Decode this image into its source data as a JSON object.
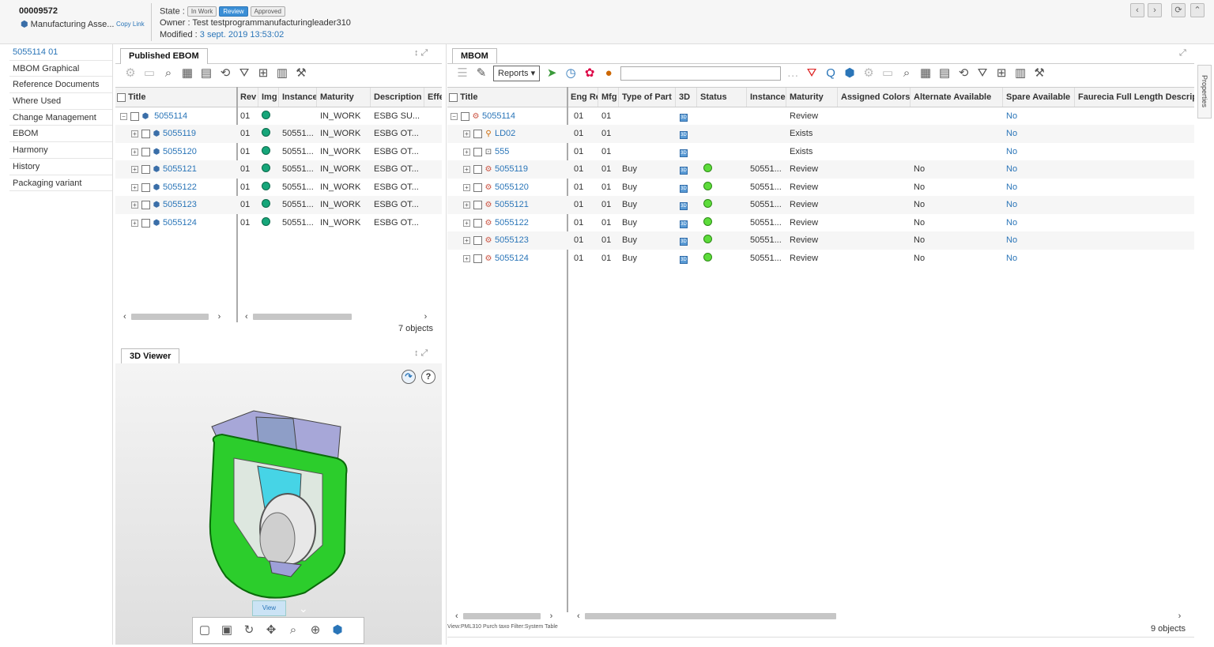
{
  "header": {
    "id": "00009572",
    "type_label": "Manufacturing Asse...",
    "copy_link": "Copy Link",
    "state_label": "State :",
    "states": [
      "In Work",
      "Review",
      "Approved"
    ],
    "owner": "Owner : Test testprogrammanufacturingleader310",
    "modified_label": "Modified :",
    "modified_value": "3 sept. 2019 13:53:02"
  },
  "sidebar": {
    "items": [
      "5055114 01",
      "MBOM Graphical",
      "Reference Documents",
      "Where Used",
      "Change Management",
      "EBOM",
      "Harmony",
      "History",
      "Packaging variant"
    ]
  },
  "ebom": {
    "tab": "Published EBOM",
    "left_header": "Title",
    "columns": [
      "Rev",
      "Img",
      "Instance",
      "Maturity",
      "Description",
      "Effe"
    ],
    "rows": [
      {
        "title": "5055114",
        "rev": "01",
        "instance": "",
        "maturity": "IN_WORK",
        "description": "ESBG SU..."
      },
      {
        "title": "5055119",
        "rev": "01",
        "instance": "50551...",
        "maturity": "IN_WORK",
        "description": "ESBG OT..."
      },
      {
        "title": "5055120",
        "rev": "01",
        "instance": "50551...",
        "maturity": "IN_WORK",
        "description": "ESBG OT..."
      },
      {
        "title": "5055121",
        "rev": "01",
        "instance": "50551...",
        "maturity": "IN_WORK",
        "description": "ESBG OT..."
      },
      {
        "title": "5055122",
        "rev": "01",
        "instance": "50551...",
        "maturity": "IN_WORK",
        "description": "ESBG OT..."
      },
      {
        "title": "5055123",
        "rev": "01",
        "instance": "50551...",
        "maturity": "IN_WORK",
        "description": "ESBG OT..."
      },
      {
        "title": "5055124",
        "rev": "01",
        "instance": "50551...",
        "maturity": "IN_WORK",
        "description": "ESBG OT..."
      }
    ],
    "count": "7 objects"
  },
  "viewer": {
    "tab": "3D Viewer",
    "view_label": "View"
  },
  "mbom": {
    "tab": "MBOM",
    "reports": "Reports",
    "left_header": "Title",
    "properties": "Properties",
    "columns": [
      "Eng Re",
      "Mfg I",
      "Type of Part",
      "3D",
      "Status",
      "Instance",
      "Maturity",
      "Assigned Colors",
      "Alternate Available",
      "Spare Available",
      "Faurecia Full Length Descrip"
    ],
    "rows": [
      {
        "title": "5055114",
        "eng": "01",
        "mfg": "01",
        "type": "",
        "status": false,
        "instance": "",
        "maturity": "Review",
        "alt": "",
        "spare": "No"
      },
      {
        "title": "LD02",
        "eng": "01",
        "mfg": "01",
        "type": "",
        "status": false,
        "instance": "",
        "maturity": "Exists",
        "alt": "",
        "spare": "No"
      },
      {
        "title": "555",
        "eng": "01",
        "mfg": "01",
        "type": "",
        "status": false,
        "instance": "",
        "maturity": "Exists",
        "alt": "",
        "spare": "No"
      },
      {
        "title": "5055119",
        "eng": "01",
        "mfg": "01",
        "type": "Buy",
        "status": true,
        "instance": "50551...",
        "maturity": "Review",
        "alt": "No",
        "spare": "No"
      },
      {
        "title": "5055120",
        "eng": "01",
        "mfg": "01",
        "type": "Buy",
        "status": true,
        "instance": "50551...",
        "maturity": "Review",
        "alt": "No",
        "spare": "No"
      },
      {
        "title": "5055121",
        "eng": "01",
        "mfg": "01",
        "type": "Buy",
        "status": true,
        "instance": "50551...",
        "maturity": "Review",
        "alt": "No",
        "spare": "No"
      },
      {
        "title": "5055122",
        "eng": "01",
        "mfg": "01",
        "type": "Buy",
        "status": true,
        "instance": "50551...",
        "maturity": "Review",
        "alt": "No",
        "spare": "No"
      },
      {
        "title": "5055123",
        "eng": "01",
        "mfg": "01",
        "type": "Buy",
        "status": true,
        "instance": "50551...",
        "maturity": "Review",
        "alt": "No",
        "spare": "No"
      },
      {
        "title": "5055124",
        "eng": "01",
        "mfg": "01",
        "type": "Buy",
        "status": true,
        "instance": "50551...",
        "maturity": "Review",
        "alt": "No",
        "spare": "No"
      }
    ],
    "footer": "View:PML310 Purch taxo Filter:System Table",
    "count": "9 objects"
  }
}
